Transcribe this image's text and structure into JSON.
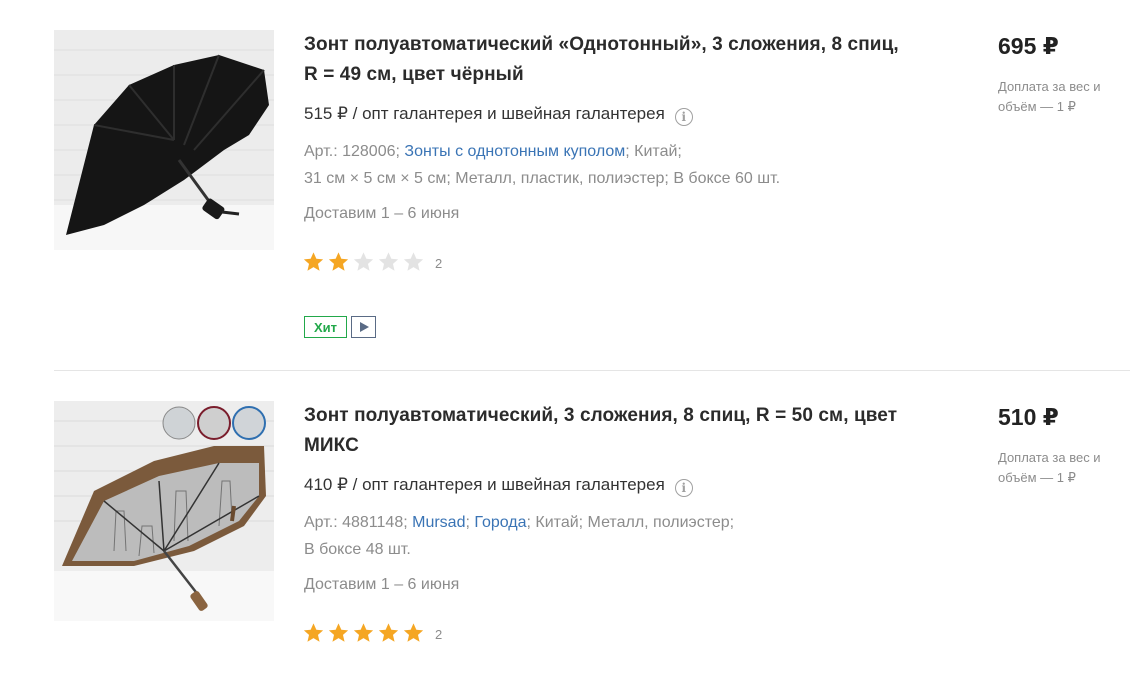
{
  "products": [
    {
      "title": "Зонт полуавтоматический «Однотонный», 3 сложения, 8 спиц, R = 49 см, цвет чёрный",
      "wholesale": "515 ₽ / опт галантерея и швейная галантерея",
      "meta": {
        "article": "Арт.: 128006;",
        "links": [
          "Зонты с однотонным куполом"
        ],
        "country": "; Китай;",
        "specs": "31 см × 5 см × 5 см; Металл, пластик, полиэстер; В боксе 60 шт."
      },
      "delivery": "Доставим 1 – 6 июня",
      "rating": 2,
      "rating_count": "2",
      "badges": [
        "Хит"
      ],
      "price": "695 ₽",
      "surcharge": "Доплата за вес и объём — 1 ₽",
      "image_icon": "black-umbrella-photo"
    },
    {
      "title": "Зонт полуавтоматический, 3 сложения, 8 спиц, R = 50 см, цвет МИКС",
      "wholesale": "410 ₽ / опт галантерея и швейная галантерея",
      "meta": {
        "article": "Арт.: 4881148;",
        "links": [
          "Mursad",
          "Города"
        ],
        "country": "; Китай; Металл, полиэстер;",
        "specs": "В боксе 48 шт."
      },
      "delivery": "Доставим 1 – 6 июня",
      "rating": 5,
      "rating_count": "2",
      "badges": [],
      "price": "510 ₽",
      "surcharge": "Доплата за вес и объём — 1 ₽",
      "image_icon": "brown-umbrella-city-print-photo"
    }
  ],
  "colors": {
    "link": "#3a74b5",
    "star_filled": "#f5a623",
    "star_empty": "#e3e3e3",
    "badge_hit": "#22a84a"
  },
  "icons": {
    "info": "info-icon",
    "play": "play-icon",
    "star": "star-icon"
  }
}
